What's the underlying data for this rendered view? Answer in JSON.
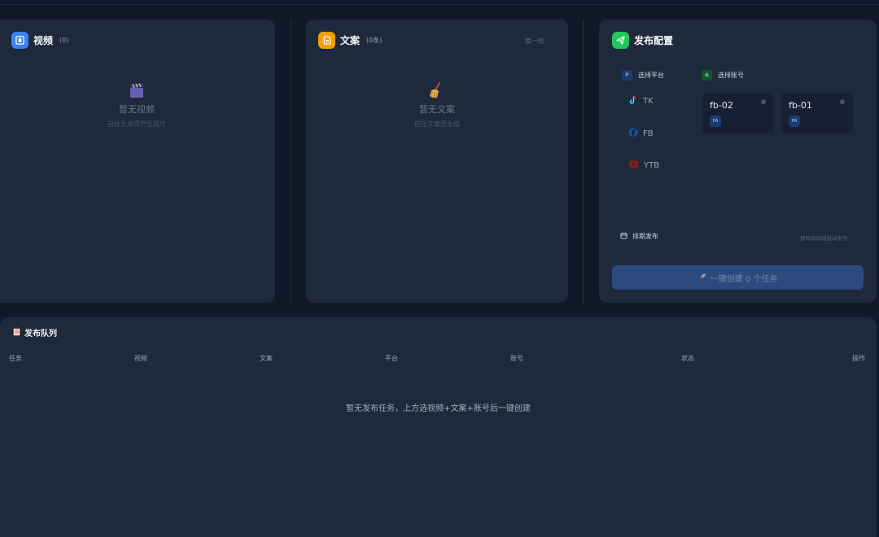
{
  "video_panel": {
    "title": "视频",
    "count": "(0)",
    "empty_title": "暂无视频",
    "empty_hint": "前往生成页产生成片",
    "icon": "film-icon",
    "accent": "#3b82f6"
  },
  "copy_panel": {
    "title": "文案",
    "count": "(0条)",
    "refresh_label": "换一批",
    "empty_title": "暂无文案",
    "empty_hint": "前往文案页生成",
    "icon": "document-icon",
    "accent": "#f59e0b"
  },
  "publish_panel": {
    "title": "发布配置",
    "icon": "send-icon",
    "accent": "#22c55e",
    "platform_section": {
      "tag": "P",
      "label": "选择平台"
    },
    "account_section": {
      "tag": "A",
      "label": "选择账号"
    },
    "platforms": [
      {
        "label": "TK",
        "icon": "tiktok-icon"
      },
      {
        "label": "FB",
        "icon": "facebook-icon"
      },
      {
        "label": "YTB",
        "icon": "youtube-icon"
      }
    ],
    "accounts": [
      {
        "name": "fb-02",
        "badge": "FA"
      },
      {
        "name": "fb-01",
        "badge": "FA"
      }
    ],
    "schedule_label": "排期发布",
    "schedule_hint": "按时间间隔自动发布",
    "create_button": "一键创建 0 个任务"
  },
  "queue": {
    "title": "发布队列",
    "columns": [
      "任务",
      "视频",
      "文案",
      "平台",
      "账号",
      "状态",
      "操作"
    ],
    "empty_text": "暂无发布任务，上方选视频+文案+账号后一键创建"
  }
}
